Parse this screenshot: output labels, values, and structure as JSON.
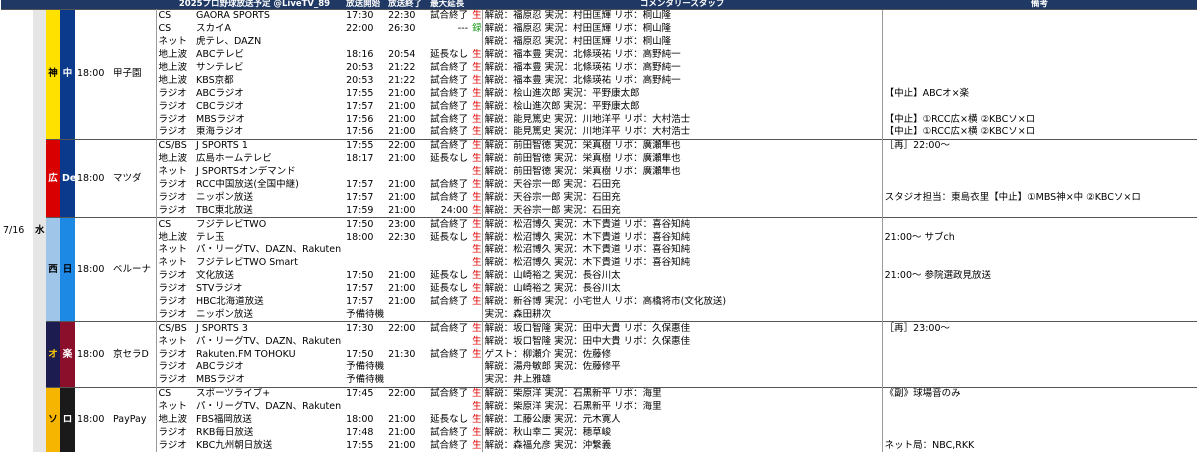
{
  "header": {
    "title": "2025プロ野球放送予定 @LiveTV_89",
    "col_start": "放送開始",
    "col_end": "放送終了",
    "col_ext": "最大延長",
    "col_staff": "コメンタリースタッフ",
    "col_note": "備考"
  },
  "date": "7/16",
  "weekday": "水",
  "colors": {
    "header_bg": "#1f3864",
    "live_mark": "#e00000",
    "record_mark": "#1a9a1a"
  },
  "games": [
    {
      "team1": "神",
      "team1_bg": "#ffe100",
      "team1_fg": "#000000",
      "team2": "中",
      "team2_bg": "#0b3a8c",
      "team2_fg": "#ffffff",
      "time": "18:00",
      "venue": "甲子園",
      "rows": [
        {
          "type": "CS",
          "station": "GAORA SPORTS",
          "start": "17:30",
          "end": "22:30",
          "ext": "試合終了",
          "mark": "生",
          "mark_kind": "live",
          "staff": "解説：福原忍 実況：村田匡輝 リポ：桐山隆",
          "note": ""
        },
        {
          "type": "CS",
          "station": "スカイA",
          "start": "22:00",
          "end": "26:30",
          "ext": "---",
          "mark": "録",
          "mark_kind": "rec",
          "staff": "解説：福原忍 実況：村田匡輝 リポ：桐山隆",
          "note": ""
        },
        {
          "type": "ネット",
          "station": "虎テレ、DAZN",
          "start": "",
          "end": "",
          "ext": "",
          "mark": "",
          "mark_kind": "",
          "staff": "解説：福原忍 実況：村田匡輝 リポ：桐山隆",
          "note": ""
        },
        {
          "type": "地上波",
          "station": "ABCテレビ",
          "start": "18:16",
          "end": "20:54",
          "ext": "延長なし",
          "mark": "生",
          "mark_kind": "live",
          "staff": "解説：福本豊 実況：北條瑛祐 リポ：高野純一",
          "note": ""
        },
        {
          "type": "地上波",
          "station": "サンテレビ",
          "start": "20:53",
          "end": "21:22",
          "ext": "試合終了",
          "mark": "生",
          "mark_kind": "live",
          "staff": "解説：福本豊 実況：北條瑛祐 リポ：高野純一",
          "note": ""
        },
        {
          "type": "地上波",
          "station": "KBS京都",
          "start": "20:53",
          "end": "21:22",
          "ext": "試合終了",
          "mark": "生",
          "mark_kind": "live",
          "staff": "解説：福本豊 実況：北條瑛祐 リポ：高野純一",
          "note": ""
        },
        {
          "type": "ラジオ",
          "station": "ABCラジオ",
          "start": "17:55",
          "end": "21:00",
          "ext": "試合終了",
          "mark": "生",
          "mark_kind": "live",
          "staff": "解説：桧山進次郎 実況：平野康太郎",
          "note": "【中止】ABCオ×楽"
        },
        {
          "type": "ラジオ",
          "station": "CBCラジオ",
          "start": "17:57",
          "end": "21:00",
          "ext": "試合終了",
          "mark": "生",
          "mark_kind": "live",
          "staff": "解説：桧山進次郎 実況：平野康太郎",
          "note": ""
        },
        {
          "type": "ラジオ",
          "station": "MBSラジオ",
          "start": "17:56",
          "end": "21:00",
          "ext": "試合終了",
          "mark": "生",
          "mark_kind": "live",
          "staff": "解説：能見篤史 実況：川地洋平 リポ：大村浩士",
          "note": "【中止】①RCC広×横 ②KBCソ×ロ"
        },
        {
          "type": "ラジオ",
          "station": "東海ラジオ",
          "start": "17:56",
          "end": "21:00",
          "ext": "試合終了",
          "mark": "生",
          "mark_kind": "live",
          "staff": "解説：能見篤史 実況：川地洋平 リポ：大村浩士",
          "note": "【中止】①RCC広×横 ②KBCソ×ロ"
        }
      ]
    },
    {
      "team1": "広",
      "team1_bg": "#d80000",
      "team1_fg": "#ffffff",
      "team2": "De",
      "team2_bg": "#0b3a8c",
      "team2_fg": "#ffffff",
      "time": "18:00",
      "venue": "マツダ",
      "rows": [
        {
          "type": "CS/BS",
          "station": "J SPORTS 1",
          "start": "17:55",
          "end": "22:00",
          "ext": "試合終了",
          "mark": "生",
          "mark_kind": "live",
          "staff": "解説：前田智徳 実況：栄真樹 リポ：廣瀬隼也",
          "note": "［再］22:00～"
        },
        {
          "type": "地上波",
          "station": "広島ホームテレビ",
          "start": "18:17",
          "end": "21:00",
          "ext": "延長なし",
          "mark": "生",
          "mark_kind": "live",
          "staff": "解説：前田智徳 実況：栄真樹 リポ：廣瀬隼也",
          "note": ""
        },
        {
          "type": "ネット",
          "station": "J SPORTSオンデマンド",
          "start": "",
          "end": "",
          "ext": "",
          "mark": "生",
          "mark_kind": "live",
          "staff": "解説：前田智徳 実況：栄真樹 リポ：廣瀬隼也",
          "note": ""
        },
        {
          "type": "ラジオ",
          "station": "RCC中国放送(全国中継)",
          "start": "17:57",
          "end": "21:00",
          "ext": "試合終了",
          "mark": "生",
          "mark_kind": "live",
          "staff": "解説：天谷宗一郎 実況：石田充",
          "note": ""
        },
        {
          "type": "ラジオ",
          "station": "ニッポン放送",
          "start": "17:57",
          "end": "21:00",
          "ext": "試合終了",
          "mark": "生",
          "mark_kind": "live",
          "staff": "解説：天谷宗一郎 実況：石田充",
          "note": "スタジオ担当：東島衣里【中止】①MBS神×中 ②KBCソ×ロ"
        },
        {
          "type": "ラジオ",
          "station": "TBC東北放送",
          "start": "17:59",
          "end": "21:00",
          "ext": "24:00",
          "mark": "生",
          "mark_kind": "live",
          "staff": "解説：天谷宗一郎 実況：石田充",
          "note": ""
        }
      ]
    },
    {
      "team1": "西",
      "team1_bg": "#9fc5e8",
      "team1_fg": "#000000",
      "team2": "日",
      "team2_bg": "#1e88e5",
      "team2_fg": "#000000",
      "time": "18:00",
      "venue": "ベルーナ",
      "rows": [
        {
          "type": "CS",
          "station": "フジテレビTWO",
          "start": "17:50",
          "end": "23:00",
          "ext": "試合終了",
          "mark": "生",
          "mark_kind": "live",
          "staff": "解説：松沼博久 実況：木下貴道 リポ：喜谷知純",
          "note": ""
        },
        {
          "type": "地上波",
          "station": "テレ玉",
          "start": "18:00",
          "end": "22:30",
          "ext": "延長なし",
          "mark": "生",
          "mark_kind": "live",
          "staff": "解説：松沼博久 実況：木下貴道 リポ：喜谷知純",
          "note": "21:00～ サブch"
        },
        {
          "type": "ネット",
          "station": "パ・リーグTV、DAZN、Rakuten TV、ベースボールLIVE",
          "start": "",
          "end": "",
          "ext": "",
          "mark": "生",
          "mark_kind": "live",
          "staff": "解説：松沼博久 実況：木下貴道 リポ：喜谷知純",
          "note": ""
        },
        {
          "type": "ネット",
          "station": "フジテレビTWO Smart",
          "start": "",
          "end": "",
          "ext": "",
          "mark": "生",
          "mark_kind": "live",
          "staff": "解説：松沼博久 実況：木下貴道 リポ：喜谷知純",
          "note": ""
        },
        {
          "type": "ラジオ",
          "station": "文化放送",
          "start": "17:50",
          "end": "21:00",
          "ext": "延長なし",
          "mark": "生",
          "mark_kind": "live",
          "staff": "解説：山崎裕之 実況：長谷川太",
          "note": "21:00～ 参院選政見放送"
        },
        {
          "type": "ラジオ",
          "station": "STVラジオ",
          "start": "17:57",
          "end": "21:00",
          "ext": "延長なし",
          "mark": "生",
          "mark_kind": "live",
          "staff": "解説：山崎裕之 実況：長谷川太",
          "note": ""
        },
        {
          "type": "ラジオ",
          "station": "HBC北海道放送",
          "start": "17:57",
          "end": "21:00",
          "ext": "試合終了",
          "mark": "生",
          "mark_kind": "live",
          "staff": "解説：新谷博 実況：小宅世人 リポ：高橋将市(文化放送)",
          "note": ""
        },
        {
          "type": "ラジオ",
          "station": "ニッポン放送",
          "start": "予備待機",
          "end": "",
          "ext": "",
          "mark": "",
          "mark_kind": "",
          "staff": "実況：森田耕次",
          "note": ""
        }
      ]
    },
    {
      "team1": "オ",
      "team1_bg": "#1c1c50",
      "team1_fg": "#ffcc00",
      "team2": "楽",
      "team2_bg": "#8b0e2a",
      "team2_fg": "#ffffff",
      "time": "18:00",
      "venue": "京セラD",
      "rows": [
        {
          "type": "CS/BS",
          "station": "J SPORTS 3",
          "start": "17:30",
          "end": "22:00",
          "ext": "試合終了",
          "mark": "生",
          "mark_kind": "live",
          "staff": "解説：坂口智隆 実況：田中大貴 リポ：久保惠佳",
          "note": "［再］23:00～"
        },
        {
          "type": "ネット",
          "station": "パ・リーグTV、DAZN、Rakuten TV、ベースボールLIVE",
          "start": "",
          "end": "",
          "ext": "",
          "mark": "生",
          "mark_kind": "live",
          "staff": "解説：坂口智隆 実況：田中大貴 リポ：久保惠佳",
          "note": ""
        },
        {
          "type": "ラジオ",
          "station": "Rakuten.FM TOHOKU",
          "start": "17:50",
          "end": "21:30",
          "ext": "試合終了",
          "mark": "生",
          "mark_kind": "live",
          "staff": "ゲスト：柳瀬介 実況：佐藤修",
          "note": ""
        },
        {
          "type": "ラジオ",
          "station": "ABCラジオ",
          "start": "予備待機",
          "end": "",
          "ext": "",
          "mark": "",
          "mark_kind": "",
          "staff": "解説：湯舟敏郎 実況：佐藤修平",
          "note": ""
        },
        {
          "type": "ラジオ",
          "station": "MBSラジオ",
          "start": "予備待機",
          "end": "",
          "ext": "",
          "mark": "",
          "mark_kind": "",
          "staff": "実況：井上雅雄",
          "note": ""
        }
      ]
    },
    {
      "team1": "ソ",
      "team1_bg": "#f6b500",
      "team1_fg": "#000000",
      "team2": "ロ",
      "team2_bg": "#1a1a1a",
      "team2_fg": "#ffffff",
      "time": "18:00",
      "venue": "PayPay",
      "rows": [
        {
          "type": "CS",
          "station": "スポーツライブ+",
          "start": "17:45",
          "end": "22:00",
          "ext": "試合終了",
          "mark": "生",
          "mark_kind": "live",
          "staff": "解説：柴原洋 実況：石黒新平 リポ：海里",
          "note": "《副》球場音のみ"
        },
        {
          "type": "ネット",
          "station": "パ・リーグTV、DAZN、Rakuten TV、ベースボールLIVE",
          "start": "",
          "end": "",
          "ext": "",
          "mark": "生",
          "mark_kind": "live",
          "staff": "解説：柴原洋 実況：石黒新平 リポ：海里",
          "note": ""
        },
        {
          "type": "地上波",
          "station": "FBS福岡放送",
          "start": "18:00",
          "end": "21:00",
          "ext": "延長なし",
          "mark": "生",
          "mark_kind": "live",
          "staff": "解説：工藤公康 実況：元木寛人",
          "note": ""
        },
        {
          "type": "ラジオ",
          "station": "RKB毎日放送",
          "start": "17:48",
          "end": "21:00",
          "ext": "試合終了",
          "mark": "生",
          "mark_kind": "live",
          "staff": "解説：秋山幸二 実況：穂草峻",
          "note": ""
        },
        {
          "type": "ラジオ",
          "station": "KBC九州朝日放送",
          "start": "17:55",
          "end": "21:00",
          "ext": "試合終了",
          "mark": "生",
          "mark_kind": "live",
          "staff": "解説：森福允彦 実況：沖繋義",
          "note": "ネット局：NBC,RKK"
        }
      ]
    }
  ]
}
